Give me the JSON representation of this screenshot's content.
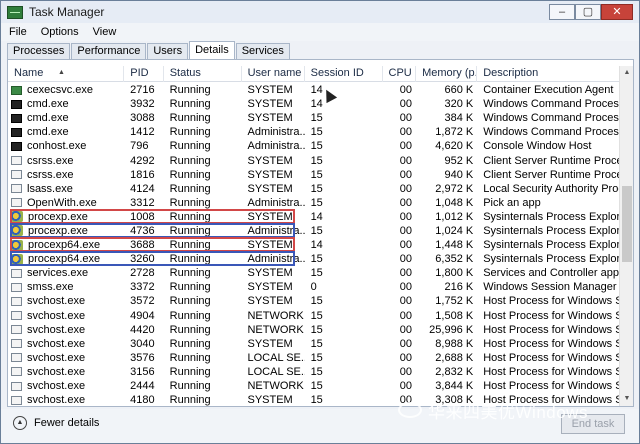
{
  "window": {
    "title": "Task Manager",
    "controls": [
      "–",
      "▢",
      "✕"
    ]
  },
  "menu": [
    "File",
    "Options",
    "View"
  ],
  "tabs": [
    "Processes",
    "Performance",
    "Users",
    "Details",
    "Services"
  ],
  "active_tab": "Details",
  "columns": [
    "Name",
    "PID",
    "Status",
    "User name",
    "Session ID",
    "CPU",
    "Memory (p...",
    "Description"
  ],
  "processes": [
    {
      "icon": "green-app-icon",
      "name": "cexecsvc.exe",
      "pid": "2716",
      "status": "Running",
      "user": "SYSTEM",
      "session": "14",
      "cpu": "00",
      "memory": "660 K",
      "description": "Container Execution Agent",
      "highlight": ""
    },
    {
      "icon": "console-icon",
      "name": "cmd.exe",
      "pid": "3932",
      "status": "Running",
      "user": "SYSTEM",
      "session": "14",
      "cpu": "00",
      "memory": "320 K",
      "description": "Windows Command Processor",
      "highlight": ""
    },
    {
      "icon": "console-icon",
      "name": "cmd.exe",
      "pid": "3088",
      "status": "Running",
      "user": "SYSTEM",
      "session": "15",
      "cpu": "00",
      "memory": "384 K",
      "description": "Windows Command Processor",
      "highlight": ""
    },
    {
      "icon": "console-icon",
      "name": "cmd.exe",
      "pid": "1412",
      "status": "Running",
      "user": "Administra...",
      "session": "15",
      "cpu": "00",
      "memory": "1,872 K",
      "description": "Windows Command Processor",
      "highlight": ""
    },
    {
      "icon": "console-icon",
      "name": "conhost.exe",
      "pid": "796",
      "status": "Running",
      "user": "Administra...",
      "session": "15",
      "cpu": "00",
      "memory": "4,620 K",
      "description": "Console Window Host",
      "highlight": ""
    },
    {
      "icon": "generic-app-icon",
      "name": "csrss.exe",
      "pid": "4292",
      "status": "Running",
      "user": "SYSTEM",
      "session": "15",
      "cpu": "00",
      "memory": "952 K",
      "description": "Client Server Runtime Process",
      "highlight": ""
    },
    {
      "icon": "generic-app-icon",
      "name": "csrss.exe",
      "pid": "1816",
      "status": "Running",
      "user": "SYSTEM",
      "session": "15",
      "cpu": "00",
      "memory": "940 K",
      "description": "Client Server Runtime Process",
      "highlight": ""
    },
    {
      "icon": "generic-app-icon",
      "name": "lsass.exe",
      "pid": "4124",
      "status": "Running",
      "user": "SYSTEM",
      "session": "15",
      "cpu": "00",
      "memory": "2,972 K",
      "description": "Local Security Authority Process",
      "highlight": ""
    },
    {
      "icon": "generic-app-icon",
      "name": "OpenWith.exe",
      "pid": "3312",
      "status": "Running",
      "user": "Administra...",
      "session": "15",
      "cpu": "00",
      "memory": "1,048 K",
      "description": "Pick an app",
      "highlight": ""
    },
    {
      "icon": "process-explorer-icon",
      "name": "procexp.exe",
      "pid": "1008",
      "status": "Running",
      "user": "SYSTEM",
      "session": "14",
      "cpu": "00",
      "memory": "1,012 K",
      "description": "Sysinternals Process Explorer",
      "highlight": "red"
    },
    {
      "icon": "process-explorer-icon",
      "name": "procexp.exe",
      "pid": "4736",
      "status": "Running",
      "user": "Administra...",
      "session": "15",
      "cpu": "00",
      "memory": "1,024 K",
      "description": "Sysinternals Process Explorer",
      "highlight": "blue"
    },
    {
      "icon": "process-explorer-icon",
      "name": "procexp64.exe",
      "pid": "3688",
      "status": "Running",
      "user": "SYSTEM",
      "session": "14",
      "cpu": "00",
      "memory": "1,448 K",
      "description": "Sysinternals Process Explorer",
      "highlight": "red"
    },
    {
      "icon": "process-explorer-icon",
      "name": "procexp64.exe",
      "pid": "3260",
      "status": "Running",
      "user": "Administra...",
      "session": "15",
      "cpu": "00",
      "memory": "6,352 K",
      "description": "Sysinternals Process Explorer",
      "highlight": "blue"
    },
    {
      "icon": "generic-app-icon",
      "name": "services.exe",
      "pid": "2728",
      "status": "Running",
      "user": "SYSTEM",
      "session": "15",
      "cpu": "00",
      "memory": "1,800 K",
      "description": "Services and Controller app",
      "highlight": ""
    },
    {
      "icon": "generic-app-icon",
      "name": "smss.exe",
      "pid": "3372",
      "status": "Running",
      "user": "SYSTEM",
      "session": "0",
      "cpu": "00",
      "memory": "216 K",
      "description": "Windows Session Manager",
      "highlight": ""
    },
    {
      "icon": "generic-app-icon",
      "name": "svchost.exe",
      "pid": "3572",
      "status": "Running",
      "user": "SYSTEM",
      "session": "15",
      "cpu": "00",
      "memory": "1,752 K",
      "description": "Host Process for Windows Se...",
      "highlight": ""
    },
    {
      "icon": "generic-app-icon",
      "name": "svchost.exe",
      "pid": "4904",
      "status": "Running",
      "user": "NETWORK ...",
      "session": "15",
      "cpu": "00",
      "memory": "1,508 K",
      "description": "Host Process for Windows Se...",
      "highlight": ""
    },
    {
      "icon": "generic-app-icon",
      "name": "svchost.exe",
      "pid": "4420",
      "status": "Running",
      "user": "NETWORK ...",
      "session": "15",
      "cpu": "00",
      "memory": "25,996 K",
      "description": "Host Process for Windows Se...",
      "highlight": ""
    },
    {
      "icon": "generic-app-icon",
      "name": "svchost.exe",
      "pid": "3040",
      "status": "Running",
      "user": "SYSTEM",
      "session": "15",
      "cpu": "00",
      "memory": "8,988 K",
      "description": "Host Process for Windows Se...",
      "highlight": ""
    },
    {
      "icon": "generic-app-icon",
      "name": "svchost.exe",
      "pid": "3576",
      "status": "Running",
      "user": "LOCAL SE...",
      "session": "15",
      "cpu": "00",
      "memory": "2,688 K",
      "description": "Host Process for Windows Se...",
      "highlight": ""
    },
    {
      "icon": "generic-app-icon",
      "name": "svchost.exe",
      "pid": "3156",
      "status": "Running",
      "user": "LOCAL SE...",
      "session": "15",
      "cpu": "00",
      "memory": "2,832 K",
      "description": "Host Process for Windows Se...",
      "highlight": ""
    },
    {
      "icon": "generic-app-icon",
      "name": "svchost.exe",
      "pid": "2444",
      "status": "Running",
      "user": "NETWORK ...",
      "session": "15",
      "cpu": "00",
      "memory": "3,844 K",
      "description": "Host Process for Windows Se...",
      "highlight": ""
    },
    {
      "icon": "generic-app-icon",
      "name": "svchost.exe",
      "pid": "4180",
      "status": "Running",
      "user": "SYSTEM",
      "session": "15",
      "cpu": "00",
      "memory": "3,308 K",
      "description": "Host Process for Windows Se...",
      "highlight": ""
    }
  ],
  "footer": {
    "fewer_details": "Fewer details",
    "end_task": "End task"
  },
  "watermark": "华来四美优Windows"
}
